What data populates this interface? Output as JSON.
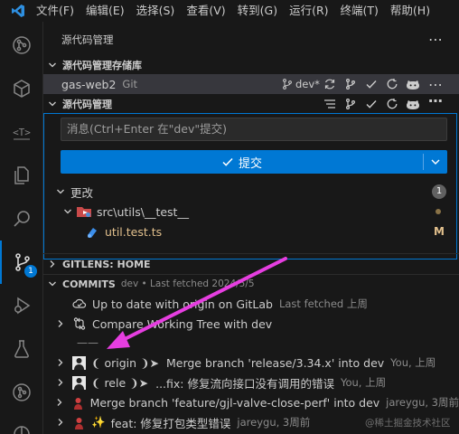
{
  "menu": [
    "文件(F)",
    "编辑(E)",
    "选择(S)",
    "查看(V)",
    "转到(G)",
    "运行(R)",
    "终端(T)",
    "帮助(H)"
  ],
  "sidebar": {
    "title": "源代码管理",
    "repos_header": "源代码管理存储库",
    "repo": {
      "name": "gas-web2",
      "type": "Git",
      "branch": "dev*"
    },
    "scm_header": "源代码管理",
    "message_placeholder": "消息(Ctrl+Enter 在\"dev\"提交)",
    "commit_label": "提交",
    "changes_label": "更改",
    "changes_count": "1",
    "folder_path": "src\\utils\\__test__",
    "file_name": "util.test.ts",
    "file_status": "M",
    "gitlens_header": "GITLENS: HOME",
    "commits_header": "COMMITS",
    "commits_meta": "dev • Last fetched 2024/5/5",
    "uptodate": "Up to date with origin on GitLab",
    "uptodate_meta": "Last fetched 上周",
    "compare": "Compare Working Tree with dev",
    "separator_line": "——",
    "commits": [
      {
        "ref": "❨ origin ❩➤",
        "msg": "Merge branch 'release/3.34.x' into dev",
        "meta": "You, 上周"
      },
      {
        "ref": "❨ rele ❩➤",
        "msg": "...fix: 修复流向接口没有调用的错误",
        "meta": "You, 上周"
      },
      {
        "ref": "",
        "msg": "Merge branch 'feature/gjl-valve-close-perf' into dev",
        "meta": "jareygu, 3周前"
      },
      {
        "ref": "✨",
        "msg": "feat: 修复打包类型错误",
        "meta": "jareygu, 3周前"
      }
    ],
    "watermark": "@稀土掘金技术社区"
  },
  "activity_badge": "1",
  "colors": {
    "accent": "#0078d4",
    "arrow": "#e63ee0",
    "modified": "#e2c08d"
  }
}
